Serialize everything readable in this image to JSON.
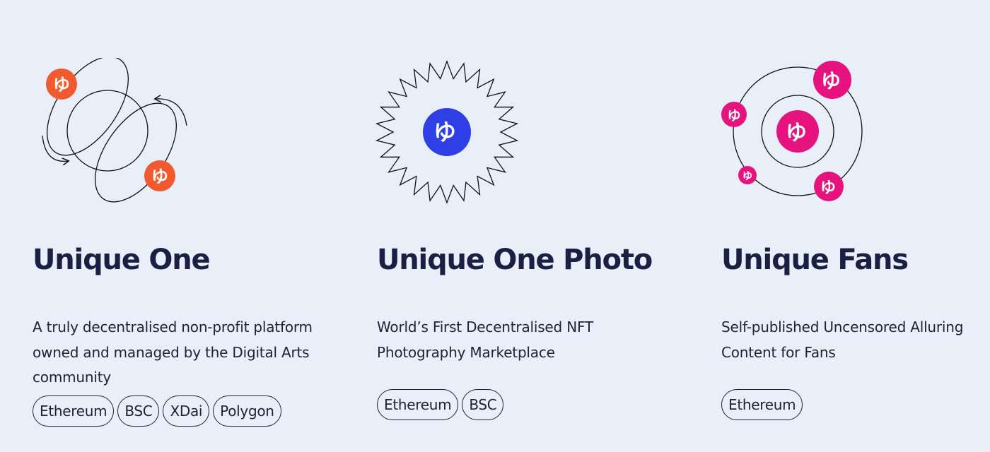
{
  "products": [
    {
      "title": "Unique One",
      "description": "A truly decentralised non-profit platform owned and managed by the Digital Arts community",
      "networks": [
        "Ethereum",
        "BSC",
        "XDai",
        "Polygon"
      ],
      "accent_color": "#f05a2e",
      "icon": "orbit-ellipses-logo-icon"
    },
    {
      "title": "Unique One Photo",
      "description": "World’s First Decentralised NFT Photography Marketplace",
      "networks": [
        "Ethereum",
        "BSC"
      ],
      "accent_color": "#2f3fe6",
      "icon": "starburst-logo-icon"
    },
    {
      "title": "Unique Fans",
      "description": "Self-published Uncensored Alluring Content for Fans",
      "networks": [
        "Ethereum"
      ],
      "accent_color": "#e6137e",
      "icon": "atom-orbits-logo-icon"
    }
  ]
}
